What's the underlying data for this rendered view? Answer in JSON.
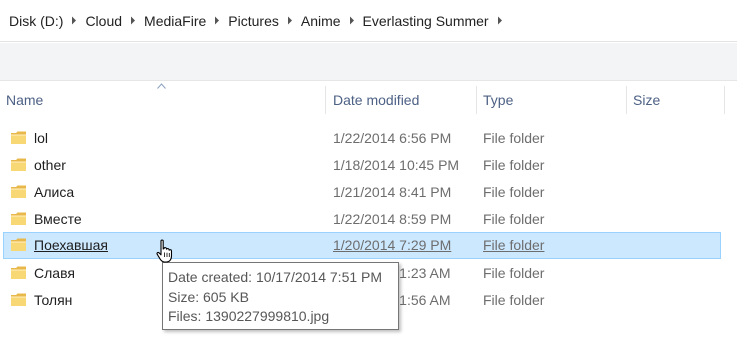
{
  "breadcrumb": [
    "Disk (D:)",
    "Cloud",
    "MediaFire",
    "Pictures",
    "Anime",
    "Everlasting Summer"
  ],
  "columns": {
    "name": "Name",
    "date_modified": "Date modified",
    "type": "Type",
    "size": "Size"
  },
  "rows": [
    {
      "name": "lol",
      "date": "1/22/2014 6:56 PM",
      "type": "File folder",
      "selected": false
    },
    {
      "name": "other",
      "date": "1/18/2014 10:45 PM",
      "type": "File folder",
      "selected": false
    },
    {
      "name": "Алиса",
      "date": "1/21/2014 8:41 PM",
      "type": "File folder",
      "selected": false
    },
    {
      "name": "Вместе",
      "date": "1/22/2014 8:59 PM",
      "type": "File folder",
      "selected": false
    },
    {
      "name": "Поехавшая",
      "date": "1/20/2014 7:29 PM",
      "type": "File folder",
      "selected": true
    },
    {
      "name": "Славя",
      "date": "1/23/2014 1:23 AM",
      "type": "File folder",
      "selected": false
    },
    {
      "name": "Толян",
      "date": "1/23/2014 1:56 AM",
      "type": "File folder",
      "selected": false
    }
  ],
  "tooltip": {
    "date_created": "Date created: 10/17/2014 7:51 PM",
    "size": "Size: 605 KB",
    "files": "Files: 1390227999810.jpg"
  },
  "colors": {
    "selection_bg": "#cce8ff",
    "selection_border": "#99d1ff",
    "header_text": "#4d6185",
    "folder_yellow": "#f8d775"
  },
  "icons": {
    "folder": "folder-icon",
    "separator": "chevron-right-icon",
    "sort": "sort-up-icon",
    "cursor": "hand-pointer-icon"
  }
}
